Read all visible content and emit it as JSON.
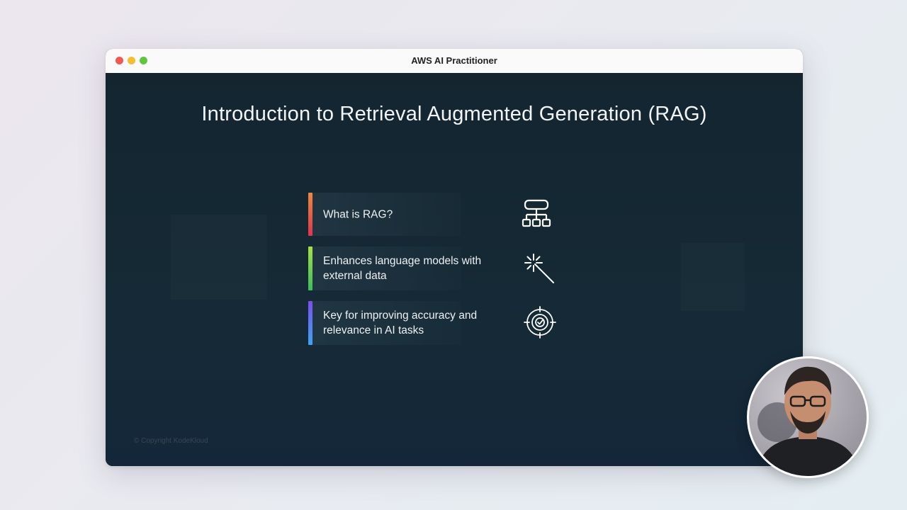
{
  "window": {
    "title": "AWS AI Practitioner"
  },
  "slide": {
    "title": "Introduction to Retrieval Augmented Generation (RAG)",
    "items": [
      {
        "text": "What is RAG?",
        "icon": "hierarchy-icon"
      },
      {
        "text": "Enhances language models with external data",
        "icon": "magic-wand-icon"
      },
      {
        "text": "Key for improving accuracy and relevance in AI tasks",
        "icon": "target-check-icon"
      }
    ],
    "copyright": "© Copyright KodeKloud"
  },
  "presenter": {
    "icon": "presenter-avatar"
  },
  "colors": {
    "slide_bg": "#152630",
    "bar1": [
      "#f08a3c",
      "#e0344f"
    ],
    "bar2": [
      "#a6e04a",
      "#3ebd5c"
    ],
    "bar3": [
      "#7b4ff0",
      "#3fa3f2"
    ]
  }
}
